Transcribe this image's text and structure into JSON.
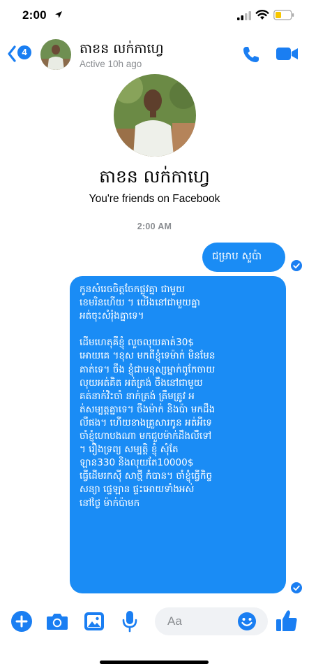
{
  "status_bar": {
    "time": "2:00",
    "icons": [
      "location-arrow-icon",
      "cellular-signal-icon",
      "wifi-icon",
      "battery-icon"
    ]
  },
  "header": {
    "back_badge_count": "4",
    "contact_name": "តាខន លក់កាហ្វេ",
    "active_status": "Active 10h ago"
  },
  "profile": {
    "name": "តាខន លក់កាហ្វេ",
    "subtitle": "You're friends on Facebook"
  },
  "conversation": {
    "timestamp": "2:00 AM",
    "messages": [
      {
        "text": "ជម្រាប សួប៉ា"
      },
      {
        "text": "កូនសំរេចចិត្តចែកផ្លូវគ្នា ជាមួយ\nខេមរិនហើយ ។ យើងនៅជាមួយគ្នា\nអត់ចុះសំរ៉ុងគ្នាទេ។\n\nដើមហេតុគឺខ្ញុំ លួចលុយគាត់30$\nអោយគេ ។ខុស មកពីខ្ញុំទេម៉ាក់ មិនមែន\nគាត់ទេ។ ចឹង ខ្ញុំជាមនុស្សម្នាក់ពូកែចាយ\nលុយអត់គិត អត់ត្រង់ ចឹងនៅជាមួយ\nគត់នាក់វិះចាំ នាក់ត្រង់ ត្រឹមត្រូវ អ\nត់សម្បត្តគ្នាទេ។ ចឹងម៉ាក់ និងប៉ា មកដឹង\nលឺផង។ ហើយខាងគ្រួសារកូន អត់អីទេ\nចាំខ្ញុំហោបងណា មកជួបម៉ាក់ដឹងលឺទៅ\n។ រឿងទ្រព្យ សម្បត្តិ ខ្ញុំ សុំតែ\nឡាន330 និងលុយតែ10000$\nធ្វើដើមរកស៊ី សាថ្មី កំបាន។ ចាំខ្ញុំធ្វើកិច្ច\nសន្យា ផ្ទេឡាន ផ្ទះអោយទាំងអស់\nនៅថ្ងៃ ម៉ាក់ប៉ាមក"
      }
    ]
  },
  "composer": {
    "placeholder": "Aa",
    "icons": [
      "plus-icon",
      "camera-icon",
      "photo-icon",
      "microphone-icon",
      "emoji-icon",
      "thumbs-up-icon"
    ]
  },
  "colors": {
    "accent": "#1a7ef2",
    "bubble": "#1a8cf5",
    "muted_text": "#8a8d91"
  }
}
